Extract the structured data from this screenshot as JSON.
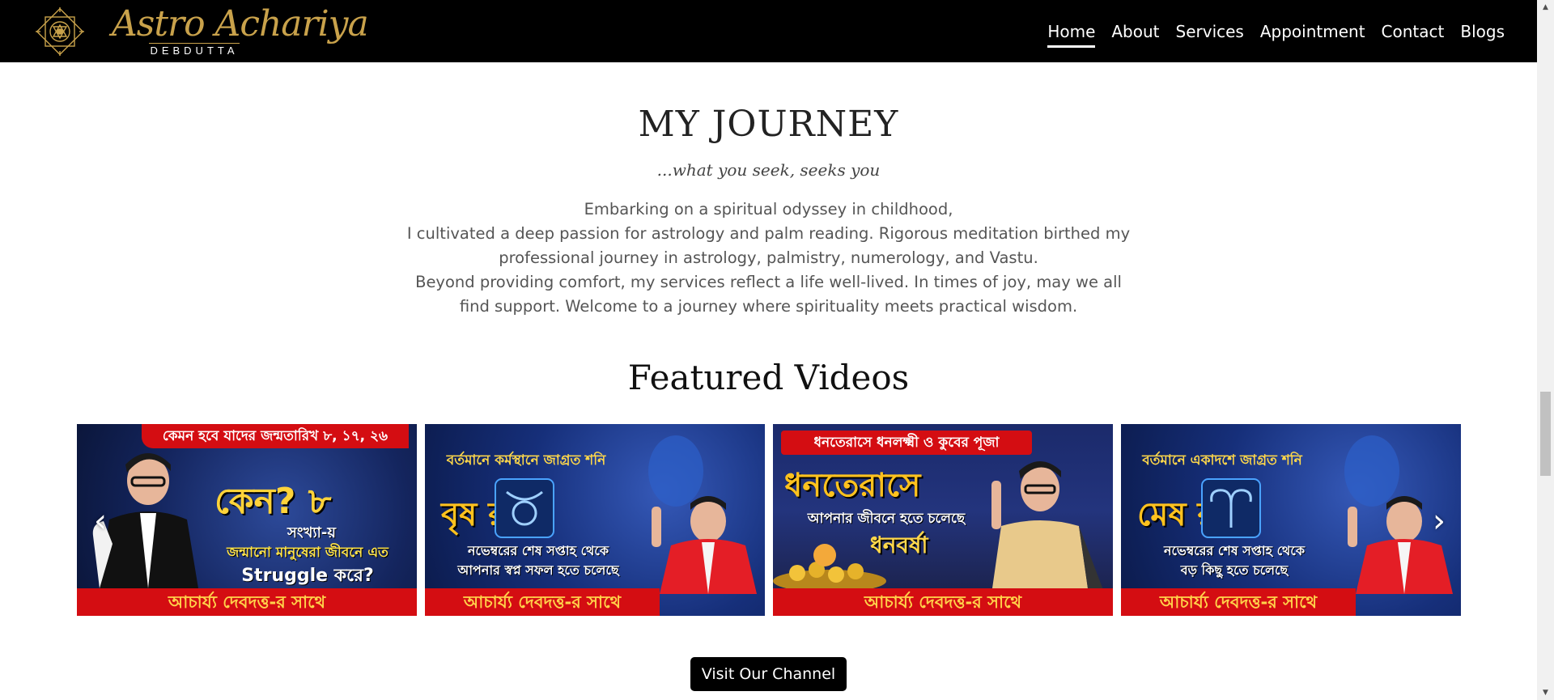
{
  "header": {
    "brand_script": "Astro Achariya",
    "brand_sub": "DEBDUTTA",
    "nav": [
      {
        "label": "Home",
        "active": true
      },
      {
        "label": "About",
        "active": false
      },
      {
        "label": "Services",
        "active": false
      },
      {
        "label": "Appointment",
        "active": false
      },
      {
        "label": "Contact",
        "active": false
      },
      {
        "label": "Blogs",
        "active": false
      }
    ]
  },
  "journey": {
    "title": "MY JOURNEY",
    "tagline": "...what you seek, seeks you",
    "paragraph_1": "Embarking on a spiritual odyssey in childhood,",
    "paragraph_2": "I cultivated a deep passion for astrology and palm reading. Rigorous meditation birthed my professional journey in astrology, palmistry, numerology, and Vastu.",
    "paragraph_3": "Beyond providing comfort, my services reflect a life well-lived. In times of joy, may we all find support. Welcome to a journey where spirituality meets practical wisdom."
  },
  "featured": {
    "title": "Featured Videos",
    "videos": [
      {
        "top": "কেমন হবে যাদের জন্মতারিখ ৮, ১৭, ২৬",
        "big": "কেন? ৮",
        "line1": "সংখ্যা-য়",
        "line2": "জন্মানো মানুষেরা জীবনে এত",
        "line3": "Struggle করে?",
        "bottom": "আচার্য্য দেবদত্ত-র সাথে"
      },
      {
        "top": "বর্তমানে কর্মস্থানে জাগ্রত শনি",
        "big": "বৃষ রাশি",
        "line1": "নভেম্বরের শেষ সপ্তাহ থেকে",
        "line2": "আপনার স্বপ্ন সফল হতে চলেছে",
        "line3": "",
        "bottom": "আচার্য্য দেবদত্ত-র সাথে"
      },
      {
        "top": "ধনতেরাসে ধনলক্ষ্মী ও কুবের পূজা",
        "big": "ধনতেরাসে",
        "line1": "আপনার জীবনে হতে চলেছে",
        "line2": "ধনবর্ষা",
        "line3": "",
        "bottom": "আচার্য্য দেবদত্ত-র সাথে"
      },
      {
        "top": "বর্তমানে একাদশে জাগ্রত শনি",
        "big": "মেষ রাশি",
        "line1": "নভেম্বরের শেষ সপ্তাহ থেকে",
        "line2": "বড় কিছু হতে চলেছে",
        "line3": "",
        "bottom": "আচার্য্য দেবদত্ত-র সাথে"
      }
    ],
    "prev_icon": "‹",
    "next_icon": "›",
    "button_label": "Visit Our Channel"
  },
  "scrollbar": {
    "up": "▲",
    "down": "▼"
  },
  "colors": {
    "header_bg": "#000000",
    "gold": "#c9a24b",
    "banner_red": "#d40d12",
    "banner_yellow": "#ffd24a"
  }
}
